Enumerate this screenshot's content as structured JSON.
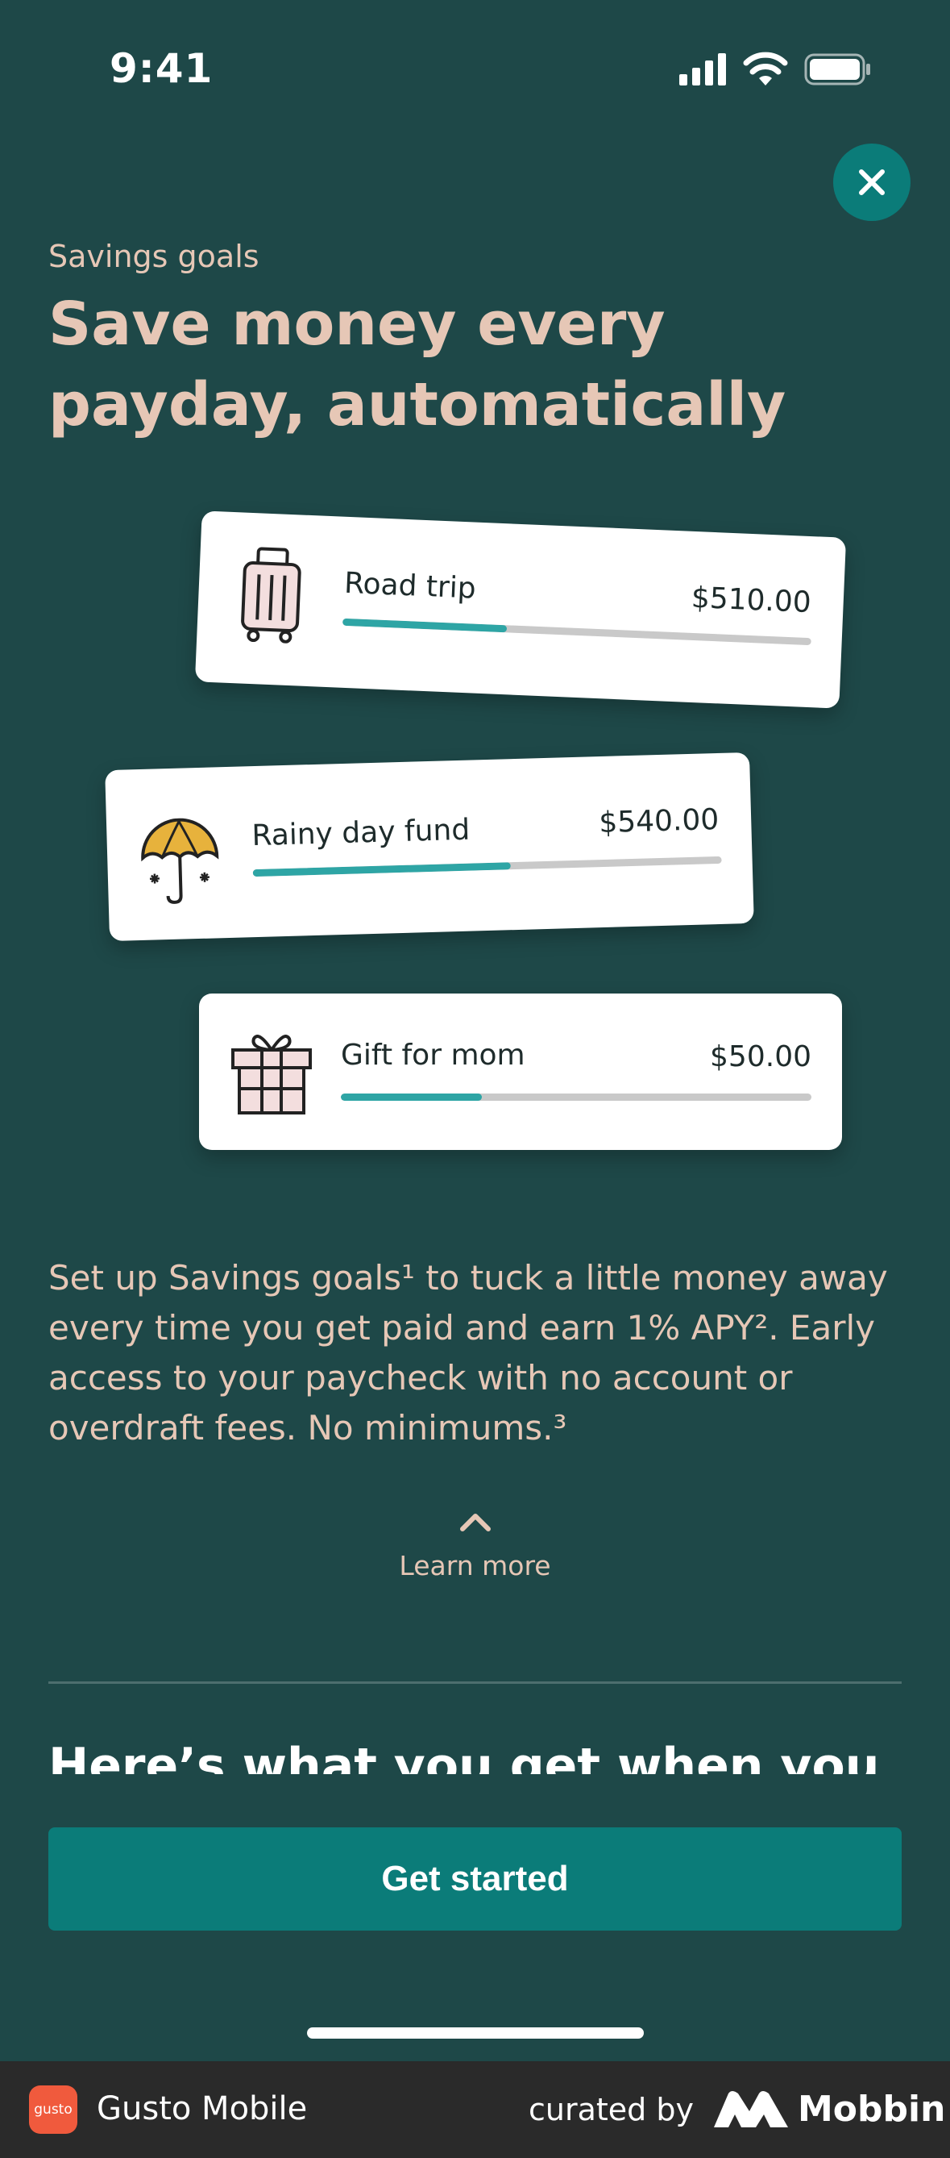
{
  "status_bar": {
    "time": "9:41"
  },
  "header": {
    "eyebrow": "Savings goals",
    "title": "Save money every payday, automatically"
  },
  "goals": [
    {
      "name": "Road trip",
      "amount": "$510.00",
      "progress": 0.35,
      "icon": "suitcase-icon"
    },
    {
      "name": "Rainy day fund",
      "amount": "$540.00",
      "progress": 0.55,
      "icon": "umbrella-icon"
    },
    {
      "name": "Gift for mom",
      "amount": "$50.00",
      "progress": 0.3,
      "icon": "gift-icon"
    }
  ],
  "description": "Set up Savings goals¹ to tuck a little money away every time you get paid and earn 1% APY². Early access to your paycheck with no account or overdraft fees. No minimums.³",
  "learn_more": "Learn more",
  "section_peek": "Here’s what you get when you set",
  "cta": "Get started",
  "footer": {
    "logo_text": "gusto",
    "app_name": "Gusto Mobile",
    "curated_by": "curated by",
    "brand": "Mobbin"
  },
  "colors": {
    "background": "#1e4848",
    "accent": "#0b7c79",
    "heading": "#e6c7b6",
    "progress": "#2ea5a5"
  }
}
